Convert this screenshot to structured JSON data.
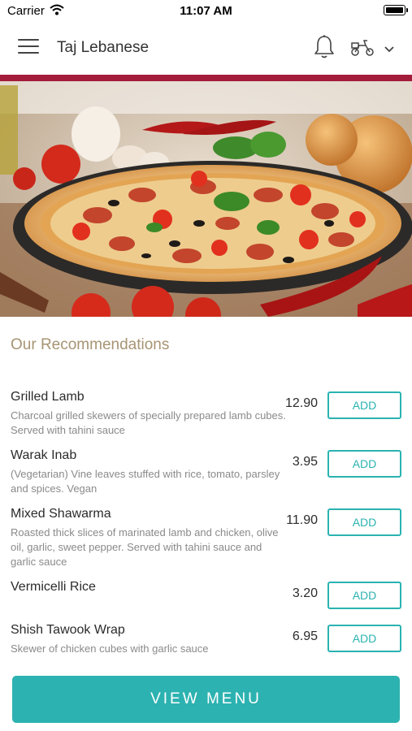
{
  "status_bar": {
    "carrier": "Carrier",
    "time": "11:07 AM"
  },
  "header": {
    "title": "Taj Lebanese",
    "icons": [
      "hamburger-menu-icon",
      "bell-icon",
      "scooter-delivery-icon",
      "chevron-down-icon"
    ]
  },
  "colors": {
    "accent": "#a31c3a",
    "teal": "#2cb2b0",
    "section_title": "#a89473"
  },
  "recommendations": {
    "title": "Our Recommendations",
    "add_label": "ADD",
    "items": [
      {
        "name": "Grilled Lamb",
        "description": "Charcoal grilled skewers of specially prepared lamb cubes. Served with tahini sauce",
        "price": "12.90"
      },
      {
        "name": "Warak Inab",
        "description": "(Vegetarian) Vine leaves stuffed with rice, tomato, parsley and spices. Vegan",
        "price": "3.95"
      },
      {
        "name": "Mixed Shawarma",
        "description": "Roasted thick slices of marinated lamb and chicken, olive oil, garlic, sweet pepper. Served with tahini sauce and garlic sauce",
        "price": "11.90"
      },
      {
        "name": "Vermicelli Rice",
        "description": "",
        "price": "3.20"
      },
      {
        "name": "Shish Tawook Wrap",
        "description": "Skewer of chicken cubes with garlic sauce",
        "price": "6.95"
      }
    ]
  },
  "footer": {
    "view_menu_label": "VIEW MENU"
  }
}
